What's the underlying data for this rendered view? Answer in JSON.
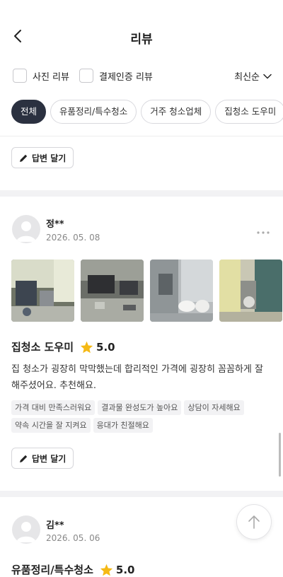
{
  "header": {
    "title": "리뷰"
  },
  "filters": {
    "photo_review_label": "사진 리뷰",
    "verified_review_label": "결제인증 리뷰",
    "sort_label": "최신순"
  },
  "categories": [
    {
      "label": "전체",
      "active": true
    },
    {
      "label": "유품정리/특수청소",
      "active": false
    },
    {
      "label": "거주 청소업체",
      "active": false
    },
    {
      "label": "집청소 도우미",
      "active": false
    }
  ],
  "reply_label": "답변 달기",
  "reviews": [
    {
      "name": "정**",
      "date": "2026. 05. 08",
      "service": "집청소 도우미",
      "rating": "5.0",
      "text": "집 청소가 굉장히 막막했는데 합리적인 가격에 굉장히 꼼꼼하게 잘 해주셨어요. 추천해요.",
      "tags_row1": [
        "가격 대비 만족스러워요",
        "결과물 완성도가 높아요",
        "상담이 자세해요"
      ],
      "tags_row2": [
        "약속 시간을 잘 지켜요",
        "응대가 친절해요"
      ]
    },
    {
      "name": "김**",
      "date": "2026. 05. 06",
      "service": "유품정리/특수청소",
      "rating": "5.0"
    }
  ],
  "colors": {
    "accent": "#2b3140",
    "star": "#f5b914",
    "tag_bg": "#f2f2f4"
  },
  "icons": [
    "chevron-left-icon",
    "chevron-down-icon",
    "pencil-icon",
    "more-dots-icon",
    "star-icon",
    "arrow-up-icon",
    "avatar-placeholder-icon"
  ]
}
